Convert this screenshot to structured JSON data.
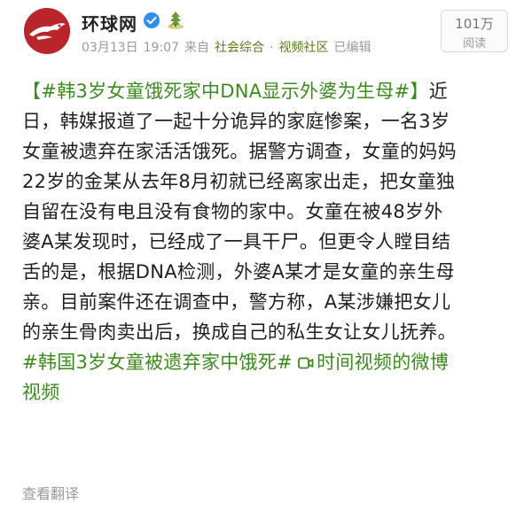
{
  "account": {
    "name": "环球网",
    "avatar_icon": "globe-eagle-logo-icon",
    "verified_icon": "verified-badge-icon",
    "badge_icon": "member-badge-icon"
  },
  "meta": {
    "date": "03月13日",
    "time": "19:07",
    "source_prefix": "来自",
    "source_1": "社会综合",
    "separator": "·",
    "source_2": "视频社区",
    "status": "已编辑"
  },
  "read_count": {
    "value": "101万",
    "label": "阅读"
  },
  "post": {
    "lines": [
      {
        "hashtag": "【#韩3岁女童饿死家中DNA显示外婆为生母#】",
        "text": "近"
      },
      {
        "text": "日，韩媒报道了一起十分诡异的家庭惨案，一名3岁"
      },
      {
        "text": "女童被遗弃在家活活饿死。据警方调查，女童的妈妈"
      },
      {
        "text": "22岁的金某从去年8月初就已经离家出走，把女童独"
      },
      {
        "text": "自留在没有电且没有食物的家中。女童在被48岁外"
      },
      {
        "text": "婆A某发现时，已经成了一具干尸。但更令人瞠目结"
      },
      {
        "text": "舌的是，根据DNA检测，外婆A某才是女童的亲生母"
      },
      {
        "text": "亲。目前案件还在调查中，警方称，A某涉嫌把女儿"
      },
      {
        "text": "的亲生骨肉卖出后，换成自己的私生女让女儿抚养。"
      }
    ],
    "hashtag_2": "#韩国3岁女童被遗弃家中饿死#",
    "video_icon": "video-camera-icon",
    "video_link_1": "时间视频的微博",
    "video_link_2": "视频"
  },
  "translate_label": "查看翻译",
  "colors": {
    "link_green": "#3d8a1f",
    "meta_gray": "#9a9a9a",
    "avatar_red": "#b8252b"
  }
}
